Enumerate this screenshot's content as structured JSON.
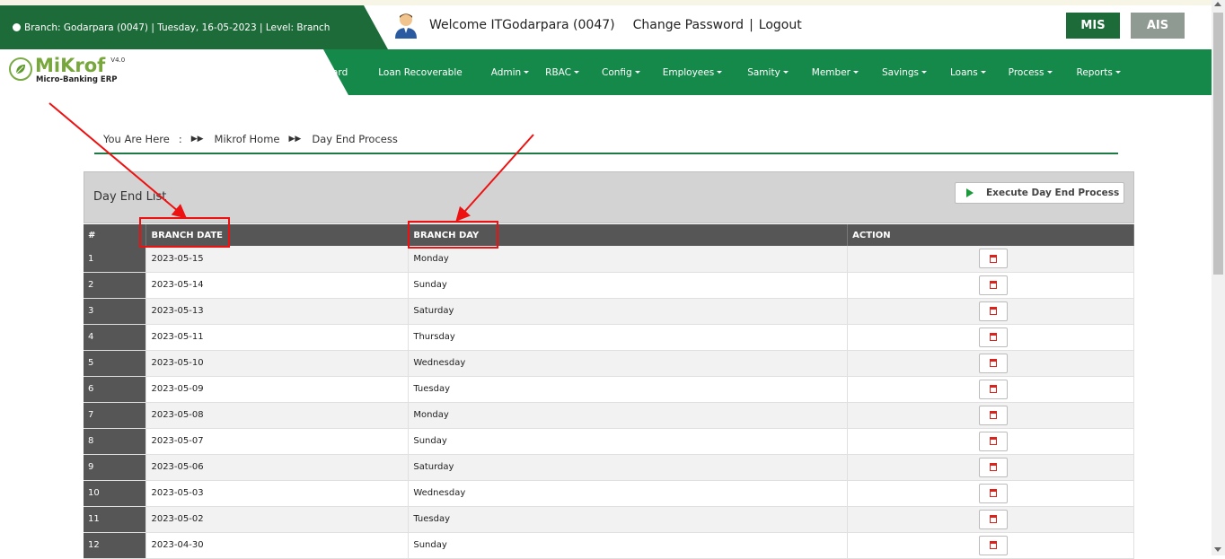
{
  "header": {
    "branch_info": "Branch: Godarpara (0047) | Tuesday, 16-05-2023 | Level: Branch",
    "welcome": "Welcome ITGodarpara (0047)",
    "change_password": "Change Password",
    "separator": "|",
    "logout": "Logout",
    "mis_label": "MIS",
    "ais_label": "AIS"
  },
  "logo": {
    "name": "MiKrof",
    "version": "V4.0",
    "subtitle": "Micro-Banking ERP"
  },
  "nav": [
    {
      "label": "ard",
      "caret": false
    },
    {
      "label": "Loan Recoverable",
      "caret": false
    },
    {
      "label": "Admin",
      "caret": true
    },
    {
      "label": "RBAC",
      "caret": true
    },
    {
      "label": "Config",
      "caret": true
    },
    {
      "label": "Employees",
      "caret": true
    },
    {
      "label": "Samity",
      "caret": true
    },
    {
      "label": "Member",
      "caret": true
    },
    {
      "label": "Savings",
      "caret": true
    },
    {
      "label": "Loans",
      "caret": true
    },
    {
      "label": "Process",
      "caret": true
    },
    {
      "label": "Reports",
      "caret": true
    }
  ],
  "breadcrumb": {
    "prefix": "You Are Here",
    "colon": ":",
    "home": "Mikrof Home",
    "current": "Day End Process"
  },
  "panel": {
    "title": "Day End List",
    "execute_label": "Execute Day End Process"
  },
  "table": {
    "headers": [
      "#",
      "BRANCH DATE",
      "BRANCH DAY",
      "ACTION"
    ],
    "rows": [
      {
        "num": "1",
        "date": "2023-05-15",
        "day": "Monday"
      },
      {
        "num": "2",
        "date": "2023-05-14",
        "day": "Sunday"
      },
      {
        "num": "3",
        "date": "2023-05-13",
        "day": "Saturday"
      },
      {
        "num": "4",
        "date": "2023-05-11",
        "day": "Thursday"
      },
      {
        "num": "5",
        "date": "2023-05-10",
        "day": "Wednesday"
      },
      {
        "num": "6",
        "date": "2023-05-09",
        "day": "Tuesday"
      },
      {
        "num": "7",
        "date": "2023-05-08",
        "day": "Monday"
      },
      {
        "num": "8",
        "date": "2023-05-07",
        "day": "Sunday"
      },
      {
        "num": "9",
        "date": "2023-05-06",
        "day": "Saturday"
      },
      {
        "num": "10",
        "date": "2023-05-03",
        "day": "Wednesday"
      },
      {
        "num": "11",
        "date": "2023-05-02",
        "day": "Tuesday"
      },
      {
        "num": "12",
        "date": "2023-04-30",
        "day": "Sunday"
      }
    ]
  },
  "colors": {
    "brand_dark": "#1e6b3a",
    "nav_green": "#14894a",
    "table_header": "#565656",
    "annotation_red": "#e11111",
    "delete_red": "#d9231d"
  },
  "icons": [
    "globe-icon",
    "user-avatar-icon",
    "leaf-logo-icon",
    "fast-forward-icon",
    "play-icon",
    "trash-icon"
  ]
}
